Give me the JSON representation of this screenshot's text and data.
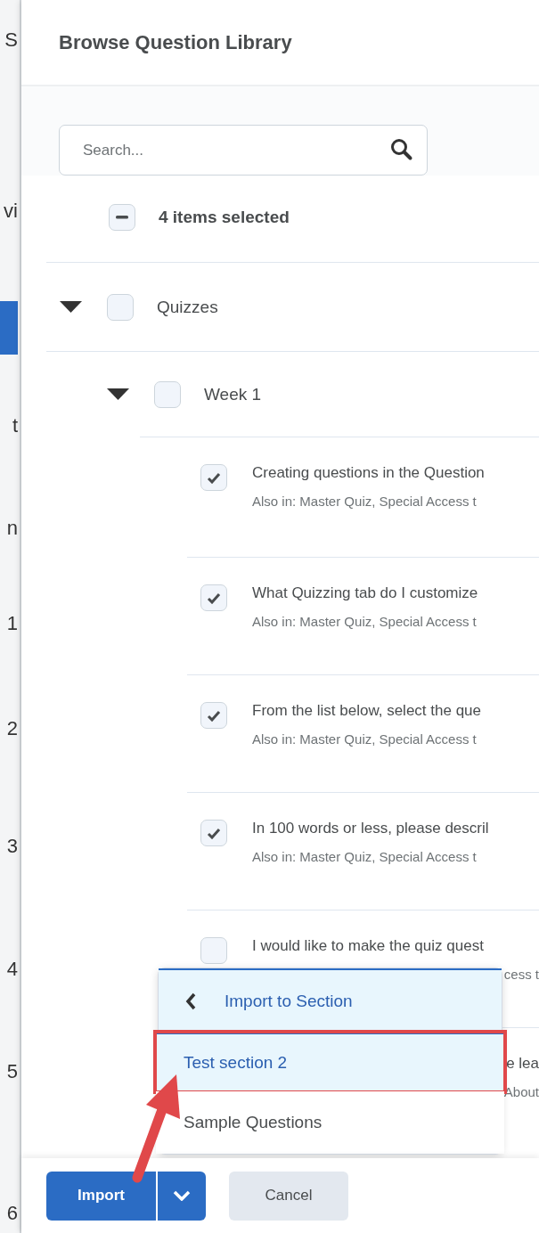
{
  "background_page": [
    {
      "kind": "text",
      "text": "S"
    },
    {
      "kind": "text",
      "text": "vi"
    },
    {
      "kind": "bar"
    },
    {
      "kind": "text",
      "text": "t"
    },
    {
      "kind": "text",
      "text": "n"
    },
    {
      "kind": "text",
      "text": "1"
    },
    {
      "kind": "text",
      "text": "2"
    },
    {
      "kind": "text",
      "text": "3"
    },
    {
      "kind": "text",
      "text": "4"
    },
    {
      "kind": "text",
      "text": "5"
    },
    {
      "kind": "text",
      "text": "6"
    }
  ],
  "dialog": {
    "title": "Browse Question Library"
  },
  "search": {
    "placeholder": "Search..."
  },
  "select_all": {
    "label": "4 items selected",
    "indeterminate": true
  },
  "tree": [
    {
      "label": "Quizzes",
      "expanded": true,
      "checked": false,
      "children": [
        {
          "label": "Week 1",
          "expanded": true,
          "checked": false
        }
      ]
    }
  ],
  "questions": [
    {
      "kind": "full",
      "title": "Creating questions in the Question",
      "subtitle": "Also in: Master Quiz, Special Access t",
      "checked": true
    },
    {
      "kind": "full",
      "title": "What Quizzing tab do I customize",
      "subtitle": "Also in: Master Quiz, Special Access t",
      "checked": true
    },
    {
      "kind": "full",
      "title": "From the list below, select the que",
      "subtitle": "Also in: Master Quiz, Special Access t",
      "checked": true
    },
    {
      "kind": "full",
      "title": "In 100 words or less, please descril",
      "subtitle": "Also in: Master Quiz, Special Access t",
      "checked": true
    },
    {
      "kind": "partly_covered",
      "title": "I would like to make the quiz quest",
      "subtitle": "cess t",
      "checked": false
    },
    {
      "kind": "tail_only",
      "title": "e lea",
      "subtitle": "About"
    }
  ],
  "menu": {
    "header": "Import to Section",
    "items": [
      {
        "label": "Test section 2",
        "highlighted": true
      },
      {
        "label": "Sample Questions",
        "highlighted": false
      }
    ]
  },
  "buttons": {
    "primary": "Import",
    "secondary": "Cancel"
  }
}
